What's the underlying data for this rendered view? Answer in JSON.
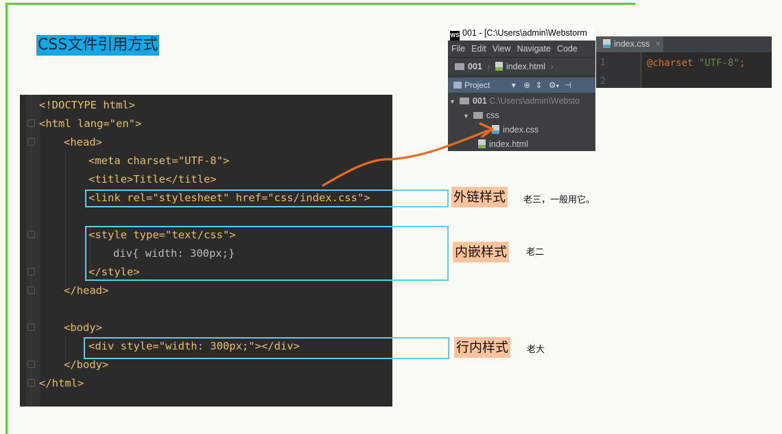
{
  "slide": {
    "title": "CSS文件引用方式"
  },
  "code": {
    "lines": [
      "<!DOCTYPE html>",
      "<html lang=\"en\">",
      "<head>",
      "<meta charset=\"UTF-8\">",
      "<title>Title</title>",
      "<link rel=\"stylesheet\" href=\"css/index.css\">",
      "",
      "<style type=\"text/css\">",
      "div{ width: 300px;}",
      "</style>",
      "</head>",
      "",
      "<body>",
      "<div style=\"width: 300px;\"></div>",
      "</body>",
      "</html>"
    ]
  },
  "labels": {
    "external": "外链样式",
    "external_note": "老三，一般用它。",
    "embedded": "内嵌样式",
    "embedded_note": "老二",
    "inline": "行内样式",
    "inline_note": "老大"
  },
  "ide": {
    "logo": "WS",
    "title": "001 - [C:\\Users\\admin\\Webstorm",
    "menu": [
      "File",
      "Edit",
      "View",
      "Navigate",
      "Code"
    ],
    "breadcrumb_project": "001",
    "breadcrumb_file": "index.html",
    "toolbar_label": "Project",
    "tree": {
      "root": "001",
      "root_path": "C:\\Users\\admin\\Websto",
      "folder": "css",
      "css_file": "index.css",
      "html_file": "index.html"
    }
  },
  "editor2": {
    "tab_label": "index.css",
    "line_numbers": [
      "1",
      "2"
    ],
    "code_keyword": "@charset",
    "code_string": "\"UTF-8\"",
    "code_semicolon": ";"
  },
  "colors": {
    "frame_green": "#63c73f",
    "title_bg": "#14a7e4",
    "highlight_border": "#66c9e6",
    "label_bg": "#fbc49c",
    "arrow": "#ef6a1f"
  }
}
